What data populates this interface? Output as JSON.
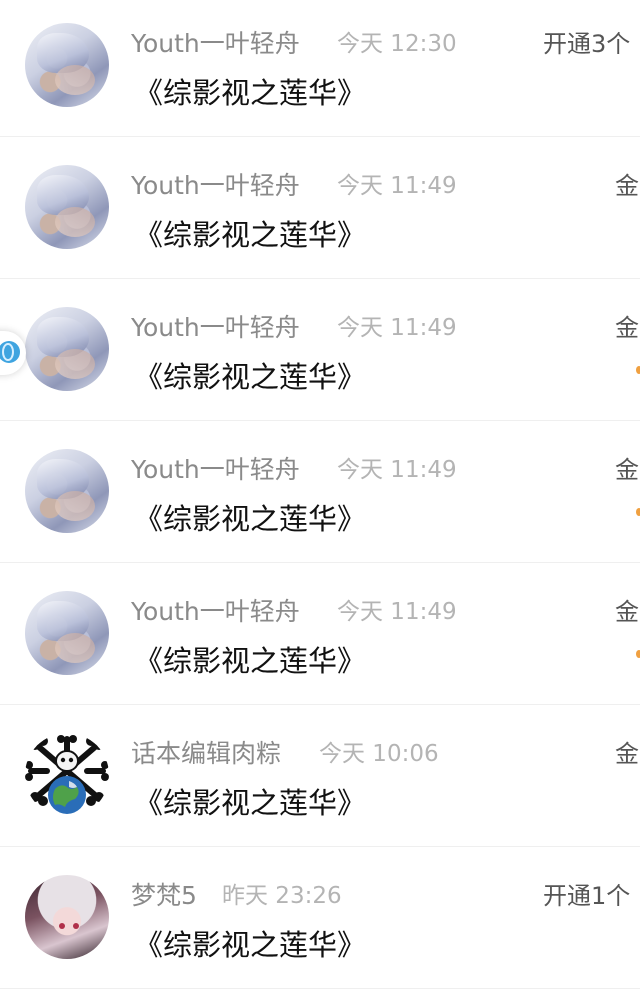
{
  "messages": [
    {
      "name": "Youth一叶轻舟",
      "time": "今天 12:30",
      "title": "《综影视之莲华》",
      "right": "开通3个",
      "avatar": "anime-avatar"
    },
    {
      "name": "Youth一叶轻舟",
      "time": "今天 11:49",
      "title": "《综影视之莲华》",
      "right": "金",
      "avatar": "anime-avatar"
    },
    {
      "name": "Youth一叶轻舟",
      "time": "今天 11:49",
      "title": "《综影视之莲华》",
      "right": "金",
      "avatar": "anime-avatar"
    },
    {
      "name": "Youth一叶轻舟",
      "time": "今天 11:49",
      "title": "《综影视之莲华》",
      "right": "金",
      "avatar": "anime-avatar"
    },
    {
      "name": "Youth一叶轻舟",
      "time": "今天 11:49",
      "title": "《综影视之莲华》",
      "right": "金",
      "avatar": "anime-avatar"
    },
    {
      "name": "话本编辑肉粽",
      "time": "今天 10:06",
      "title": "《综影视之莲华》",
      "right": "金",
      "avatar": "skull-earth-avatar"
    },
    {
      "name": "梦梵5",
      "time": "昨天 23:26",
      "title": "《综影视之莲华》",
      "right": "开通1个",
      "avatar": "anime-girl-avatar"
    }
  ],
  "icons": {
    "floating_button": "globe-icon",
    "status_dot_color": "#f0a040"
  }
}
